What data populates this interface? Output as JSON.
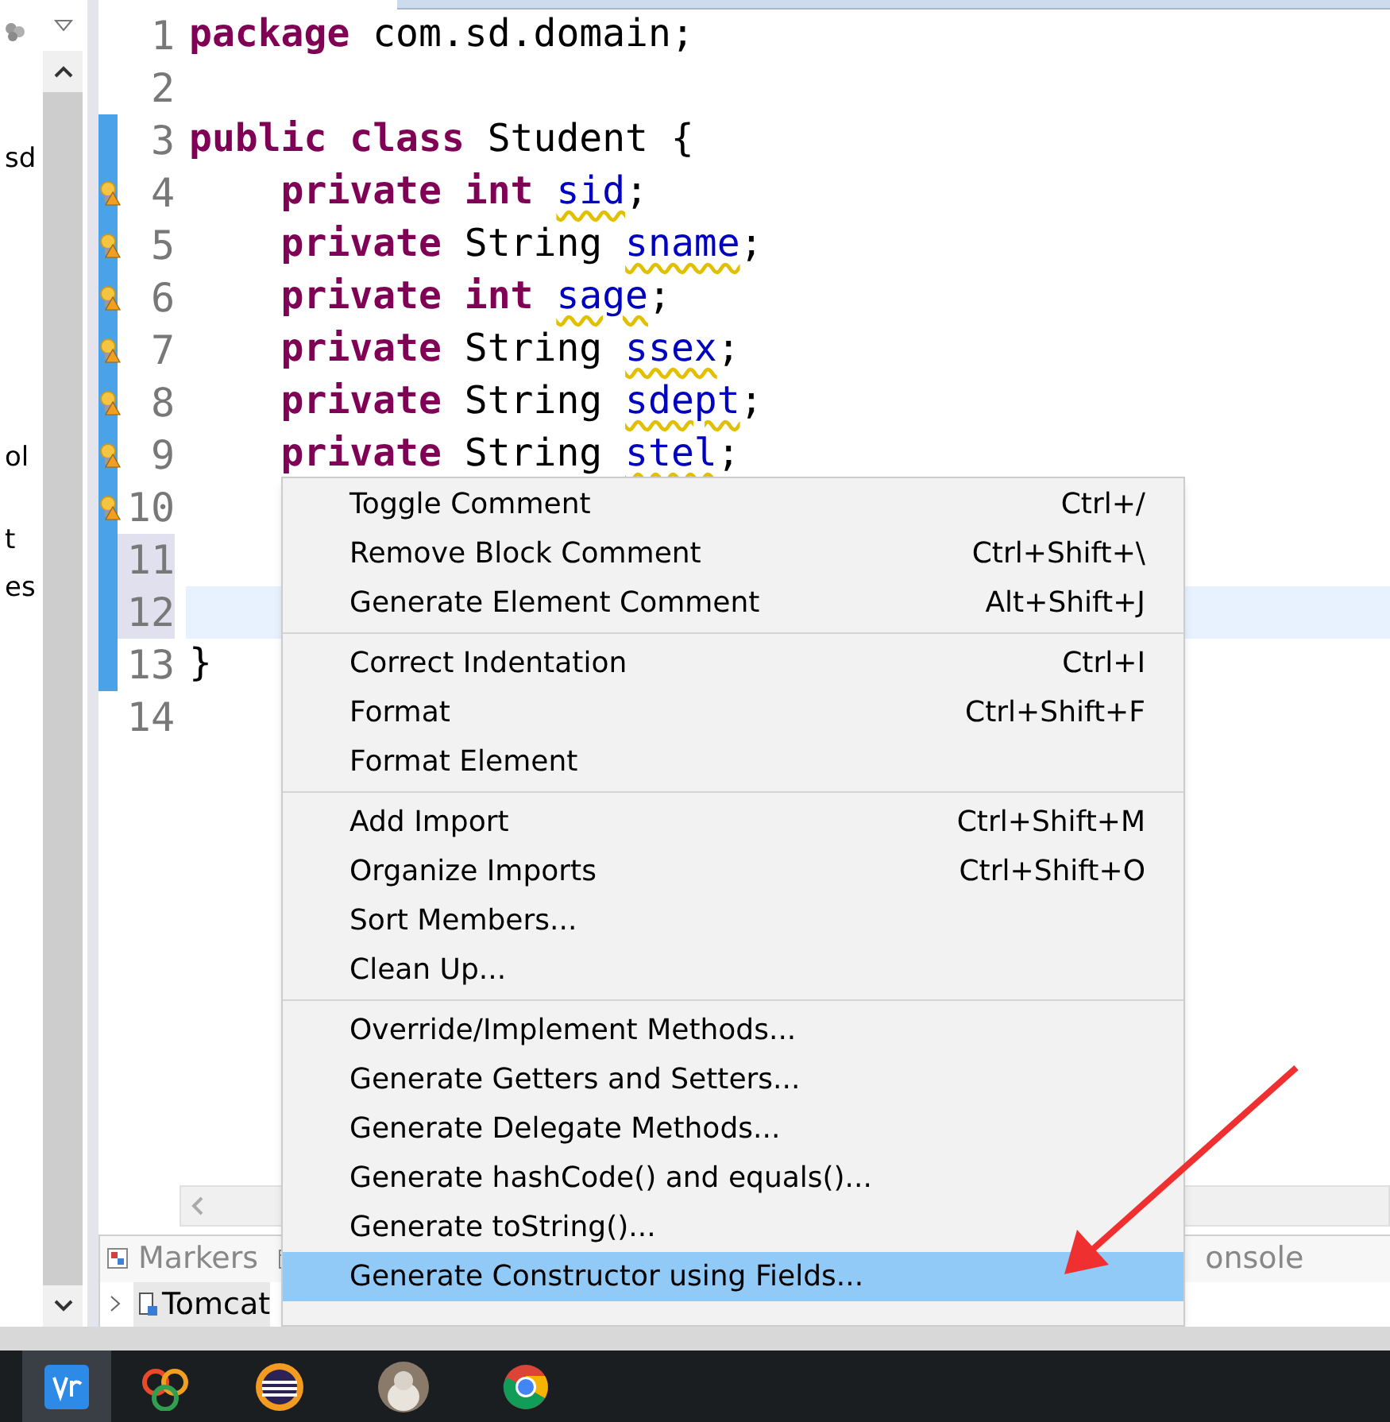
{
  "sidebar": {
    "fragments": [
      "sd",
      "ol",
      "t",
      "es"
    ]
  },
  "editor": {
    "lines": [
      {
        "number": "1",
        "current": false,
        "bulb": false,
        "changed": false,
        "tokens": [
          {
            "kind": "keyword",
            "text": "package"
          },
          {
            "kind": "plain",
            "text": " com.sd.domain;"
          }
        ]
      },
      {
        "number": "2",
        "current": false,
        "bulb": false,
        "changed": false
      },
      {
        "number": "3",
        "current": false,
        "bulb": false,
        "changed": true,
        "tokens": [
          {
            "kind": "keyword",
            "text": "public class"
          },
          {
            "kind": "plain",
            "text": " Student {"
          }
        ]
      },
      {
        "number": "4",
        "current": false,
        "bulb": true,
        "changed": true,
        "tokens": [
          {
            "kind": "keyword",
            "text": "    private int "
          },
          {
            "kind": "field",
            "text": "sid"
          },
          {
            "kind": "plain",
            "text": ";"
          }
        ]
      },
      {
        "number": "5",
        "current": false,
        "bulb": true,
        "changed": true,
        "tokens": [
          {
            "kind": "keyword",
            "text": "    private"
          },
          {
            "kind": "plain",
            "text": " String "
          },
          {
            "kind": "field",
            "text": "sname"
          },
          {
            "kind": "plain",
            "text": ";"
          }
        ]
      },
      {
        "number": "6",
        "current": false,
        "bulb": true,
        "changed": true,
        "tokens": [
          {
            "kind": "keyword",
            "text": "    private int "
          },
          {
            "kind": "field",
            "text": "sage"
          },
          {
            "kind": "plain",
            "text": ";"
          }
        ]
      },
      {
        "number": "7",
        "current": false,
        "bulb": true,
        "changed": true,
        "tokens": [
          {
            "kind": "keyword",
            "text": "    private"
          },
          {
            "kind": "plain",
            "text": " String "
          },
          {
            "kind": "field",
            "text": "ssex"
          },
          {
            "kind": "plain",
            "text": ";"
          }
        ]
      },
      {
        "number": "8",
        "current": false,
        "bulb": true,
        "changed": true,
        "tokens": [
          {
            "kind": "keyword",
            "text": "    private"
          },
          {
            "kind": "plain",
            "text": " String "
          },
          {
            "kind": "field",
            "text": "sdept"
          },
          {
            "kind": "plain",
            "text": ";"
          }
        ]
      },
      {
        "number": "9",
        "current": false,
        "bulb": true,
        "changed": true,
        "tokens": [
          {
            "kind": "keyword",
            "text": "    private"
          },
          {
            "kind": "plain",
            "text": " String "
          },
          {
            "kind": "field",
            "text": "stel"
          },
          {
            "kind": "plain",
            "text": ";"
          }
        ]
      },
      {
        "number": "10",
        "current": false,
        "bulb": true,
        "changed": true
      },
      {
        "number": "11",
        "current": true,
        "bulb": false,
        "changed": true
      },
      {
        "number": "12",
        "current": true,
        "bulb": false,
        "changed": true
      },
      {
        "number": "13",
        "current": false,
        "bulb": false,
        "changed": true,
        "tokens": [
          {
            "kind": "plain",
            "text": "}"
          }
        ]
      },
      {
        "number": "14",
        "current": false,
        "bulb": false,
        "changed": false
      }
    ]
  },
  "context_menu": {
    "groups": [
      [
        {
          "label": "Toggle Comment",
          "shortcut": "Ctrl+/",
          "selected": false
        },
        {
          "label": "Remove Block Comment",
          "shortcut": "Ctrl+Shift+\\",
          "selected": false
        },
        {
          "label": "Generate Element Comment",
          "shortcut": "Alt+Shift+J",
          "selected": false
        }
      ],
      [
        {
          "label": "Correct Indentation",
          "shortcut": "Ctrl+I",
          "selected": false
        },
        {
          "label": "Format",
          "shortcut": "Ctrl+Shift+F",
          "selected": false
        },
        {
          "label": "Format Element",
          "selected": false
        }
      ],
      [
        {
          "label": "Add Import",
          "shortcut": "Ctrl+Shift+M",
          "selected": false
        },
        {
          "label": "Organize Imports",
          "shortcut": "Ctrl+Shift+O",
          "selected": false
        },
        {
          "label": "Sort Members...",
          "selected": false
        },
        {
          "label": "Clean Up...",
          "selected": false
        }
      ],
      [
        {
          "label": "Override/Implement Methods...",
          "selected": false
        },
        {
          "label": "Generate Getters and Setters...",
          "selected": false
        },
        {
          "label": "Generate Delegate Methods...",
          "selected": false
        },
        {
          "label": "Generate hashCode() and equals()...",
          "selected": false
        },
        {
          "label": "Generate toString()...",
          "selected": false
        },
        {
          "label": "Generate Constructor using Fields...",
          "selected": true
        }
      ]
    ]
  },
  "bottom_panel": {
    "tabs": [
      {
        "label": "Markers"
      },
      {
        "label": "onsole"
      }
    ],
    "tree": [
      {
        "label": "Tomcat"
      }
    ]
  }
}
